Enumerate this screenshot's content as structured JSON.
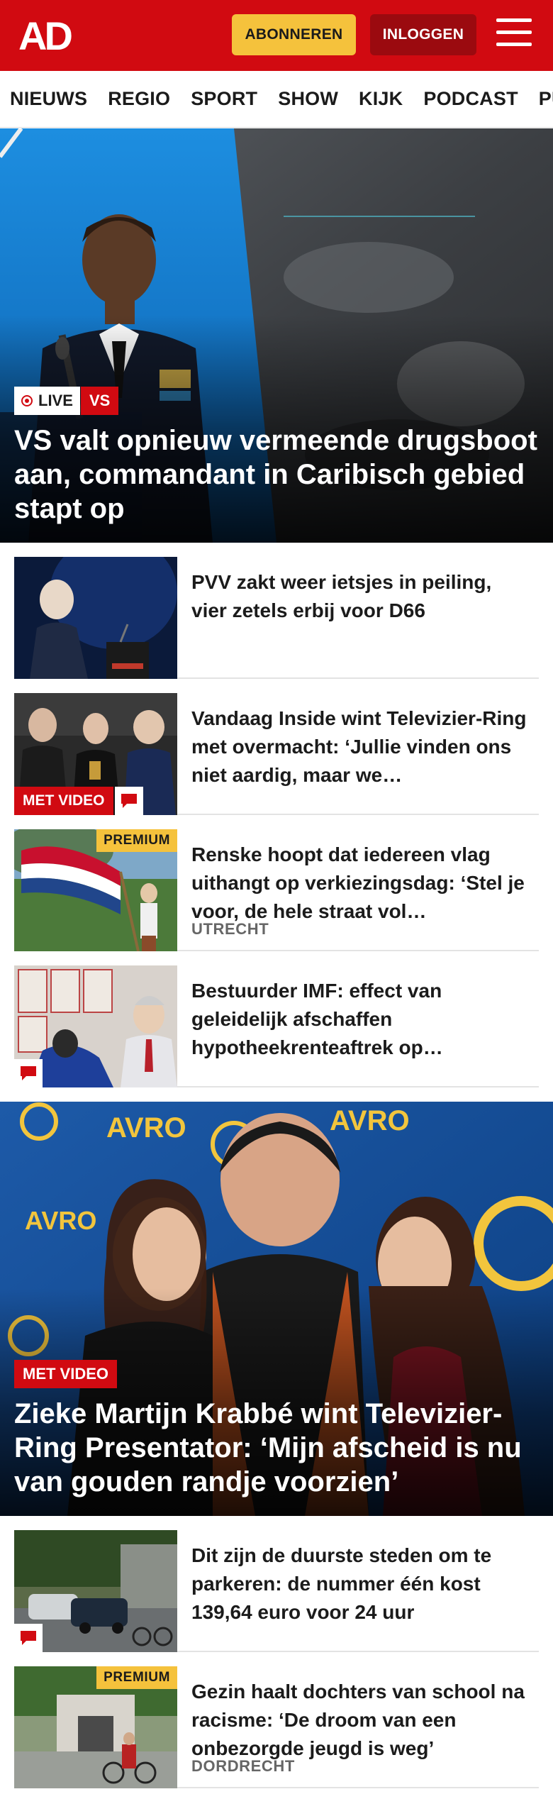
{
  "header": {
    "logo_text": "AD",
    "subscribe_label": "ABONNEREN",
    "login_label": "INLOGGEN",
    "menu_icon": "hamburger-menu-icon"
  },
  "nav": {
    "items": [
      "NIEUWS",
      "REGIO",
      "SPORT",
      "SHOW",
      "KIJK",
      "PODCAST",
      "PUZZ"
    ]
  },
  "hero1": {
    "live_label": "LIVE",
    "tag": "VS",
    "title": "VS valt opnieuw vermeende drugsboot aan, commandant in Caribisch gebied stapt op"
  },
  "articles1": [
    {
      "title": "PVV zakt weer ietsjes in peiling, vier zetels erbij voor D66"
    },
    {
      "title": "Vandaag Inside wint Televizier-Ring met overmacht: ‘Jullie vinden ons niet aardig, maar we…",
      "video_label": "MET VIDEO"
    },
    {
      "title": "Renske hoopt dat iedereen vlag uithangt op verkiezingsdag: ‘Stel je voor, de hele straat vol…",
      "premium_label": "PREMIUM",
      "region": "UTRECHT"
    },
    {
      "title": "Bestuurder IMF: effect van geleidelijk afschaffen hypotheekrenteaftrek op…"
    }
  ],
  "hero2": {
    "video_label": "MET VIDEO",
    "title": "Zieke Martijn Krabbé wint Televizier-Ring Presentator: ‘Mijn afscheid is nu van gouden randje voorzien’"
  },
  "articles2": [
    {
      "title": "Dit zijn de duurste steden om te parkeren: de nummer één kost 139,64 euro voor 24 uur"
    },
    {
      "title": "Gezin haalt dochters van school na racisme: ‘De droom van een onbezorgde jeugd is weg’",
      "premium_label": "PREMIUM",
      "region": "DORDRECHT"
    }
  ],
  "colors": {
    "brand_red": "#d10a11",
    "premium_yellow": "#f5c23c",
    "login_dark_red": "#9b0a0f"
  }
}
